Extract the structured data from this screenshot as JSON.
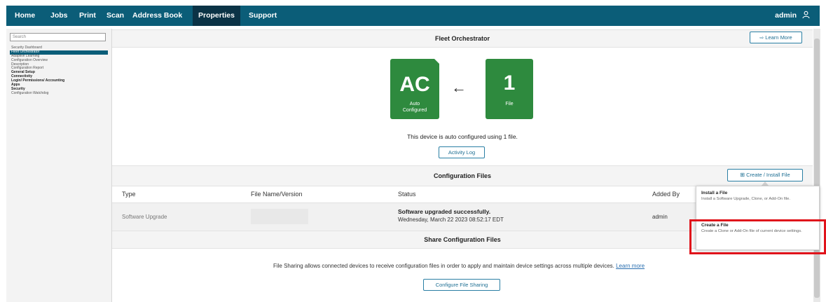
{
  "nav": {
    "items": [
      "Home",
      "Jobs",
      "Print",
      "Scan",
      "Address Book",
      "Properties",
      "Support"
    ],
    "active": "Properties",
    "user": "admin",
    "user_icon": "person-icon"
  },
  "sidebar": {
    "search_placeholder": "Search",
    "items": [
      "Security Dashboard",
      "Fleet Orchestrator",
      "Adaptive Learning",
      "Configuration Overview",
      "Description",
      "Configuration Report",
      "General Setup",
      "Connectivity",
      "Login/ Permissions/ Accounting",
      "Apps",
      "Security",
      "Configuration Watchdog"
    ]
  },
  "fleet": {
    "title": "Fleet Orchestrator",
    "learn_more": "Learn More",
    "tile_left_big": "AC",
    "tile_left_label": "Auto Configured",
    "arrow": "←",
    "tile_right_big": "1",
    "tile_right_label": "File",
    "status_text": "This device is auto configured using 1 file.",
    "activity_log": "Activity Log"
  },
  "config_files": {
    "title": "Configuration Files",
    "create_button": "Create / Install File",
    "columns": [
      "Type",
      "File Name/Version",
      "Status",
      "Added By"
    ],
    "rows": [
      {
        "type": "Software Upgrade",
        "status_title": "Software upgraded successfully.",
        "status_time": "Wednesday, March 22 2023 08:52:17 EDT",
        "added_by": "admin"
      }
    ]
  },
  "share": {
    "title": "Share Configuration Files",
    "description": "File Sharing allows connected devices to receive configuration files in order to apply and maintain device settings across multiple devices.",
    "learn_more": "Learn more",
    "configure_button": "Configure File Sharing"
  },
  "popup": {
    "install_title": "Install a File",
    "install_desc": "Install a Software Upgrade, Clone, or Add-On file.",
    "create_title": "Create a File",
    "create_desc": "Create a Clone or Add-On file of current device settings."
  },
  "colors": {
    "nav_bg": "#0b5d78",
    "nav_active": "#0b3346",
    "tile_green": "#2e8a3e",
    "highlight_red": "#e0131b"
  }
}
